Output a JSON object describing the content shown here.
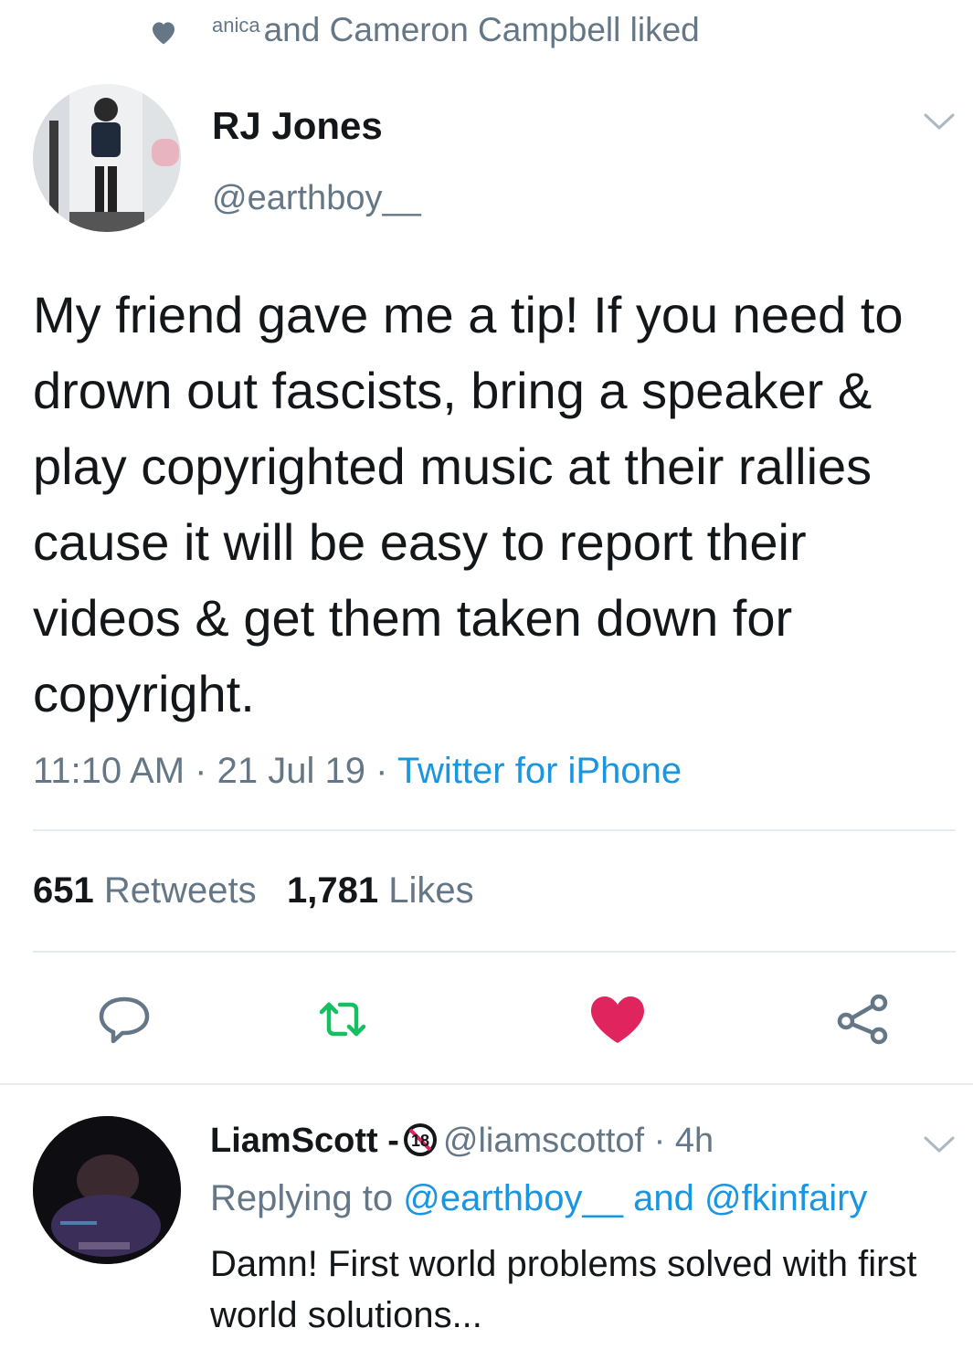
{
  "social_context": {
    "small_name": "anica",
    "text": "and Cameron Campbell liked"
  },
  "tweet": {
    "author_name": "RJ Jones",
    "author_handle": "@earthboy__",
    "text": "My friend gave me a tip! If you need to drown out fascists, bring a speaker & play copyrighted music at their rallies cause it will be easy to report their videos & get them taken down for copyright.",
    "time": "11:10 AM",
    "separator": "·",
    "date": "21 Jul 19",
    "source": "Twitter for iPhone",
    "retweet_count": "651",
    "retweet_label": "Retweets",
    "like_count": "1,781",
    "like_label": "Likes"
  },
  "reply": {
    "author_name": "LiamScott -",
    "badge": "18",
    "handle": "@liamscottof",
    "time": "· 4h",
    "replying_prefix": "Replying to",
    "mention1": "@earthboy__",
    "and": "and",
    "mention2": "@fkinfairy",
    "text": "Damn! First world problems solved with first world solutions..."
  },
  "colors": {
    "text": "#14171a",
    "secondary": "#657786",
    "link": "#1b95e0",
    "retweet_green": "#17bf63",
    "like_red": "#e0245e",
    "divider": "#e6ecf0"
  },
  "icons": [
    "heart-icon",
    "chevron-down-icon",
    "reply-icon",
    "retweet-icon",
    "like-icon",
    "share-icon",
    "age-restricted-18-icon"
  ]
}
